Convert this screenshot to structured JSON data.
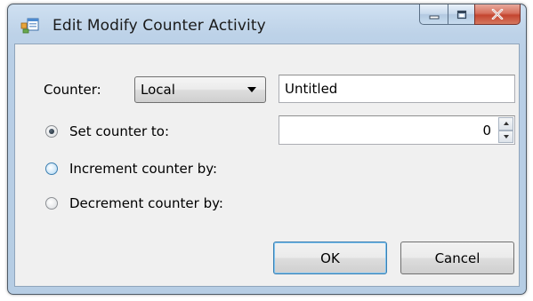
{
  "window": {
    "title": "Edit Modify Counter Activity",
    "accent": "#3c7fb1",
    "close_color": "#c4452f"
  },
  "form": {
    "counter_label": "Counter:",
    "counter_scope": "Local",
    "counter_name": "Untitled",
    "value": "0",
    "options": [
      {
        "label": "Set counter to:",
        "selected": true
      },
      {
        "label": "Increment counter by:",
        "selected": false
      },
      {
        "label": "Decrement counter by:",
        "selected": false
      }
    ]
  },
  "buttons": {
    "ok": "OK",
    "cancel": "Cancel"
  },
  "icons": {
    "app": "app-icon",
    "minimize": "minimize-icon",
    "maximize": "maximize-icon",
    "close": "close-icon",
    "dropdown": "chevron-down-icon",
    "spin_up": "spin-up-icon",
    "spin_down": "spin-down-icon"
  }
}
